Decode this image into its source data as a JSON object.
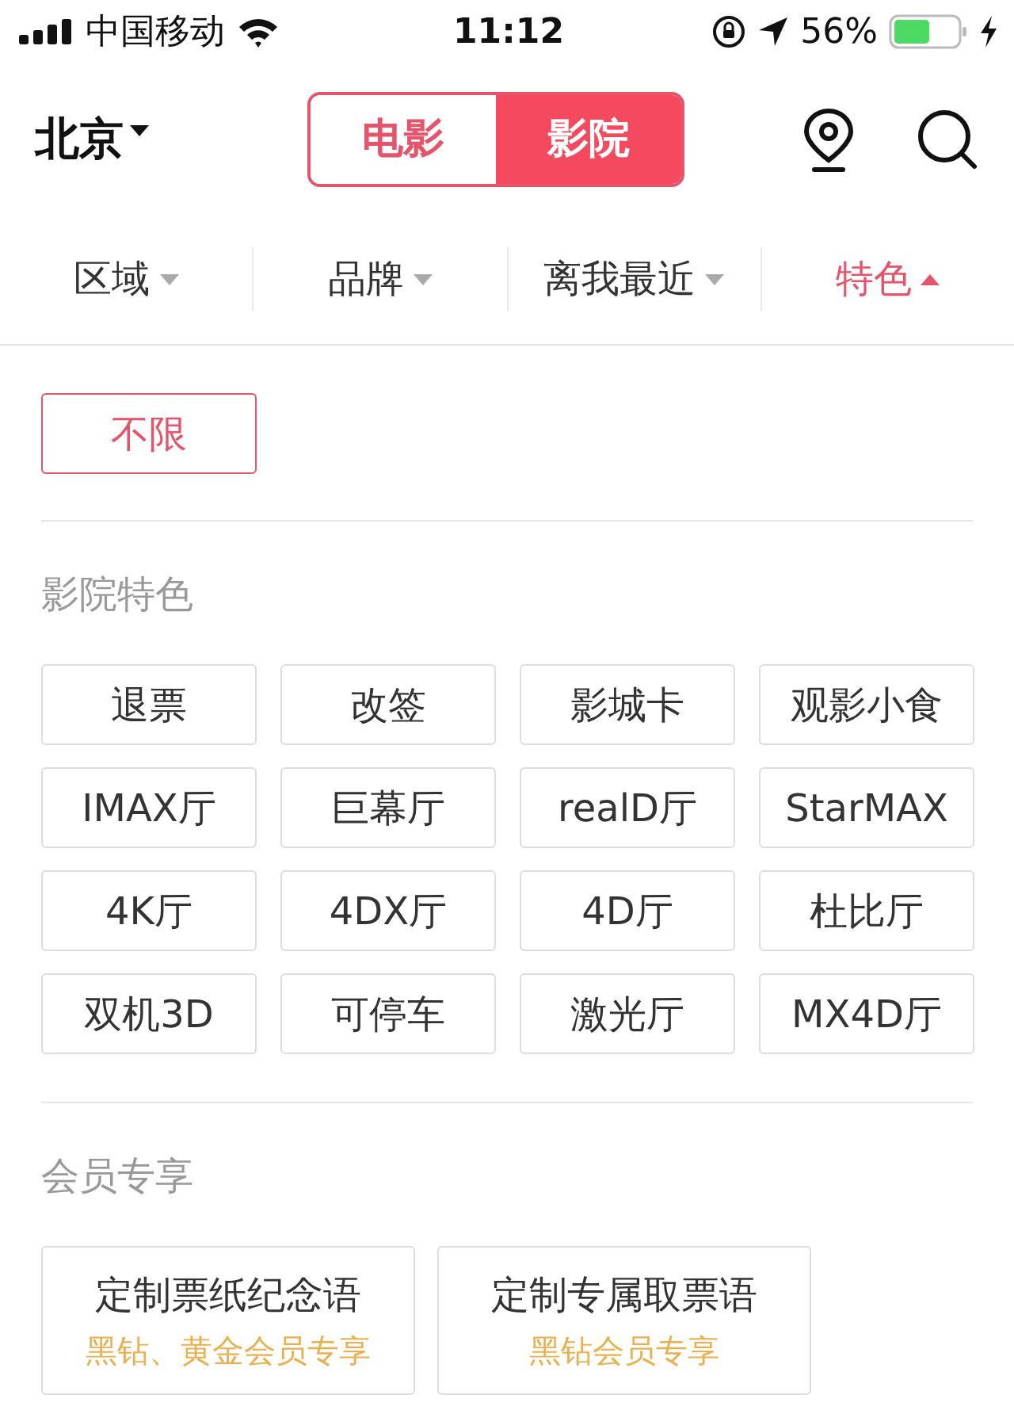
{
  "status_bar": {
    "carrier": "中国移动",
    "time": "11:12",
    "battery": "56%"
  },
  "header": {
    "city": "北京",
    "segments": [
      {
        "label": "电影",
        "selected": false
      },
      {
        "label": "影院",
        "selected": true
      }
    ]
  },
  "filters": [
    {
      "label": "区域",
      "selected": false
    },
    {
      "label": "品牌",
      "selected": false
    },
    {
      "label": "离我最近",
      "selected": false
    },
    {
      "label": "特色",
      "selected": true
    }
  ],
  "unlimited": {
    "label": "不限",
    "selected": true
  },
  "sections": [
    {
      "title": "影院特色",
      "options": [
        {
          "label": "退票",
          "selected": false
        },
        {
          "label": "改签",
          "selected": false
        },
        {
          "label": "影城卡",
          "selected": false
        },
        {
          "label": "观影小食",
          "selected": false
        },
        {
          "label": "IMAX厅",
          "selected": false
        },
        {
          "label": "巨幕厅",
          "selected": false
        },
        {
          "label": "realD厅",
          "selected": false
        },
        {
          "label": "StarMAX",
          "selected": false
        },
        {
          "label": "4K厅",
          "selected": false
        },
        {
          "label": "4DX厅",
          "selected": false
        },
        {
          "label": "4D厅",
          "selected": false
        },
        {
          "label": "杜比厅",
          "selected": false
        },
        {
          "label": "双机3D",
          "selected": false
        },
        {
          "label": "可停车",
          "selected": false
        },
        {
          "label": "激光厅",
          "selected": false
        },
        {
          "label": "MX4D厅",
          "selected": false
        }
      ]
    },
    {
      "title": "会员专享",
      "member_options": [
        {
          "label": "定制票纸纪念语",
          "note": "黑钻、黄金会员专享",
          "selected": false
        },
        {
          "label": "定制专属取票语",
          "note": "黑钻会员专享",
          "selected": false
        }
      ]
    }
  ]
}
